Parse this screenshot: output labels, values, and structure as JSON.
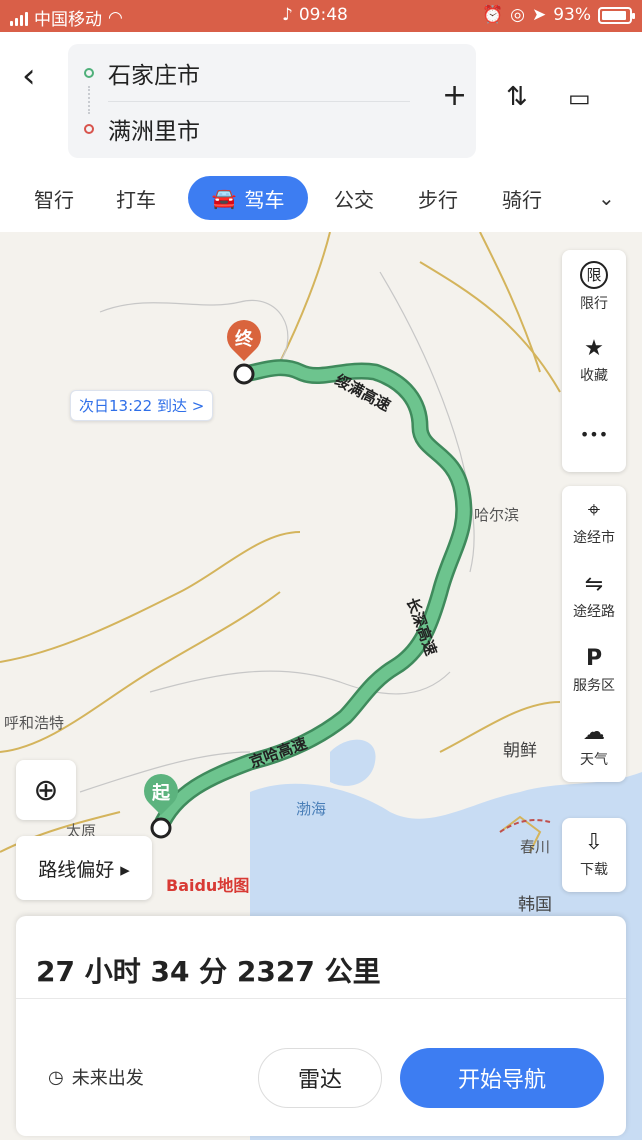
{
  "status_bar": {
    "carrier": "中国移动",
    "time": "09:48",
    "battery": "93%"
  },
  "route": {
    "origin": "石家庄市",
    "destination": "满洲里市"
  },
  "modes": {
    "items": [
      "智行",
      "打车",
      "步行",
      "公交",
      "骑行"
    ],
    "active": "驾车"
  },
  "map": {
    "arrival": "次日13:22 到达 >",
    "end_pin": "终",
    "start_pin": "起",
    "roads": [
      "绥满高速",
      "长深高速",
      "京哈高速"
    ],
    "places": [
      "哈尔滨",
      "呼和浩特",
      "朝鲜",
      "渤海",
      "太原",
      "春川",
      "韩国"
    ],
    "brand": "Baidu地图",
    "route_color": "#5cb37e"
  },
  "side_top": {
    "items": [
      {
        "icon": "限",
        "label": "限行"
      },
      {
        "icon": "★",
        "label": "收藏"
      },
      {
        "icon": "•••",
        "label": ""
      }
    ]
  },
  "side_mid": {
    "items": [
      {
        "icon": "⌖",
        "label": "途经市"
      },
      {
        "icon": "⇋",
        "label": "途经路"
      },
      {
        "icon": "P",
        "label": "服务区"
      },
      {
        "icon": "☁",
        "label": "天气"
      }
    ]
  },
  "side_bottom": {
    "items": [
      {
        "icon": "⇩",
        "label": "下载"
      }
    ]
  },
  "controls": {
    "route_pref": "路线偏好 ▸"
  },
  "summary": {
    "text": "27 小时 34 分   2327 公里",
    "future": "未来出发",
    "radar": "雷达",
    "start": "开始导航"
  }
}
